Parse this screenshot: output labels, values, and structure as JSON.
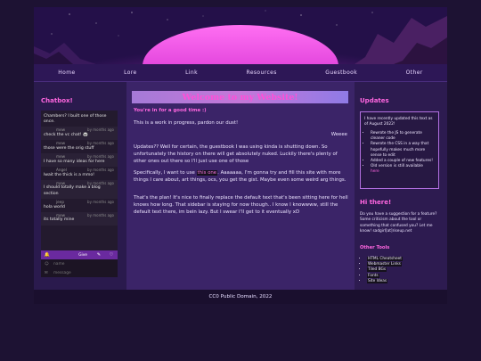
{
  "nav": {
    "items": [
      {
        "label": "Home"
      },
      {
        "label": "Lore"
      },
      {
        "label": "Link"
      },
      {
        "label": "Resources"
      },
      {
        "label": "Guestbook"
      },
      {
        "label": "Other"
      }
    ]
  },
  "chatbox": {
    "title": "Chatbox!",
    "messages": [
      {
        "who": "",
        "when": "",
        "text": "Chambers? I built one of those once."
      },
      {
        "who": "mew",
        "when": "by months ago",
        "text": "check the vc chat! 🐼"
      },
      {
        "who": "mew",
        "when": "by months ago",
        "text": "those were the orig stuff"
      },
      {
        "who": "mew",
        "when": "by months ago",
        "text": "I have so many ideas for here"
      },
      {
        "who": "Angel",
        "when": "by months ago",
        "text": "lwait the thick is a mmo!"
      },
      {
        "who": "mew",
        "when": "by months ago",
        "text": "I should totally make a blog section"
      },
      {
        "who": "jeep",
        "when": "by months ago",
        "text": "hola world"
      },
      {
        "who": "mew",
        "when": "by months ago",
        "text": "its totally mine"
      }
    ],
    "bar_label": "Give",
    "name_placeholder": "name",
    "message_placeholder": "message"
  },
  "main": {
    "welcome": "Welcome to my Website!",
    "subtitle": "You're in for a good time :)",
    "p1": "This is a work in progress, pardon our dust!",
    "sign": "Weeee",
    "p2": "Updates?? Well for certain, the guestbook I was using kinda is shutting down. So unfortunately the history on there will get absolutely nuked. Luckily there's plenty of other ones out there so I'll just use one of those",
    "p3_pre": "Specifically, I want to use ",
    "p3_hl": "this one",
    "p3_post": ". Aaaaaaa, I'm gonna try and fill this site with more things I care about, art things, ocs, you get the gist. Maybe even some weird arg things.",
    "p4": "That's the plan! It's nice to finally replace the default text that's been sitting here for hell knows how long. That sidebar is staying for now though.. I know I knowwww, still the default text there, im bein lazy. But I swear I'll get to it eventually xD"
  },
  "sidebar": {
    "updates_title": "Updates",
    "updates_intro": "I have recently updated this text as of August 2022!",
    "updates_items": [
      "Rewrote the JS to generate cleaner code",
      "Rewrote the CSS in a way that hopefully makes much more sense to edit",
      "Added a couple of new features!",
      "Old version is still available"
    ],
    "updates_link": "here",
    "hi_title": "Hi there!",
    "hi_text": "Do you have a suggestion for a feature? Some criticism about the tool or something that confused you? Let me know! sadgirl[at]riseup.net",
    "tools_title": "Other Tools",
    "tools": [
      "HTML Cheatsheet",
      "Webmaster Links",
      "Tiled BGs",
      "Fonts",
      "Site Ideas"
    ]
  },
  "footer": {
    "text": "CC0 Public Domain, 2022"
  },
  "colors": {
    "accent": "#ff66e0",
    "background": "#1d1233",
    "main_bg": "#3b2468"
  }
}
